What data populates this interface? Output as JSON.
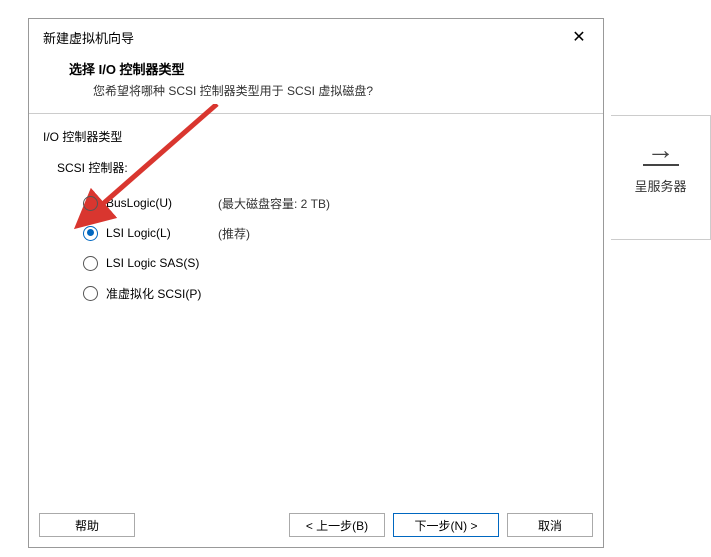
{
  "background": {
    "arrow_glyph": "→",
    "label_suffix": "呈服务器"
  },
  "dialog": {
    "title": "新建虚拟机向导",
    "close_glyph": "✕",
    "header": {
      "title": "选择 I/O 控制器类型",
      "subtitle": "您希望将哪种 SCSI 控制器类型用于 SCSI 虚拟磁盘?"
    },
    "group_label": "I/O 控制器类型",
    "sub_label": "SCSI 控制器:",
    "options": [
      {
        "label": "BusLogic(U)",
        "hint": "(最大磁盘容量: 2 TB)",
        "selected": false
      },
      {
        "label": "LSI Logic(L)",
        "hint": "(推荐)",
        "selected": true
      },
      {
        "label": "LSI Logic SAS(S)",
        "hint": "",
        "selected": false
      },
      {
        "label": "准虚拟化 SCSI(P)",
        "hint": "",
        "selected": false
      }
    ],
    "buttons": {
      "help": "帮助",
      "prev": "< 上一步(B)",
      "next": "下一步(N) >",
      "cancel": "取消"
    }
  }
}
